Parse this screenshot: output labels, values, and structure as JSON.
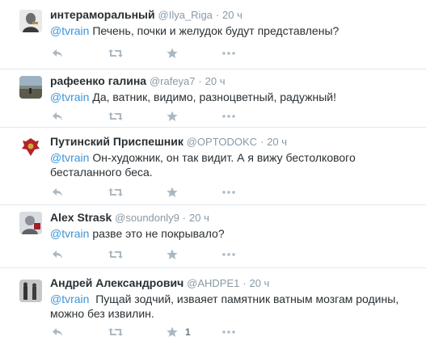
{
  "tweets": [
    {
      "fullname": "интераморальный",
      "username": "@Ilya_Riga",
      "separator": "·",
      "time": "20 ч",
      "mention": "@tvrain",
      "text": " Печень, почки и желудок будут представлены?",
      "favorite_count": ""
    },
    {
      "fullname": "рафеенко галина",
      "username": "@rafeya7",
      "separator": "·",
      "time": "20 ч",
      "mention": "@tvrain",
      "text": " Да, ватник, видимо, разноцветный, радужный!",
      "favorite_count": ""
    },
    {
      "fullname": "Путинский Приспешник",
      "username": "@OPTODOKC",
      "separator": "·",
      "time": "20 ч",
      "mention": "@tvrain",
      "text": " Он-художник, он так видит. А я вижу бестолкового бесталанного беса.",
      "favorite_count": ""
    },
    {
      "fullname": "Alex Strask",
      "username": "@soundonly9",
      "separator": "·",
      "time": "20 ч",
      "mention": "@tvrain",
      "text": " разве это не покрывало?",
      "favorite_count": ""
    },
    {
      "fullname": "Андрей Александрович",
      "username": "@AHDPE1",
      "separator": "·",
      "time": "20 ч",
      "mention": "@tvrain",
      "text": "  Пущай зодчий, изваяет памятник ватным мозгам родины, можно без извилин.",
      "favorite_count": "1"
    }
  ],
  "icons": {
    "reply": "reply-icon",
    "retweet": "retweet-icon",
    "favorite": "star-icon",
    "more": "more-dots-icon"
  },
  "colors": {
    "mention": "#3b94d9",
    "meta": "#8899a6",
    "action_icon": "#aab8c2",
    "divider": "#e1e8ed"
  }
}
